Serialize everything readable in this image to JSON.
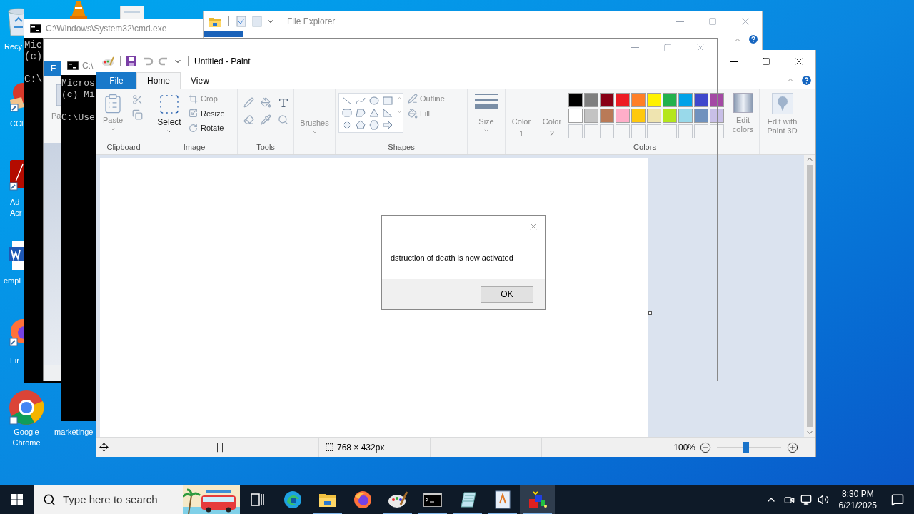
{
  "desktop": {
    "icons": [
      {
        "kind": "recycle",
        "label": "Recy"
      },
      {
        "kind": "cone"
      },
      {
        "kind": "document"
      },
      {
        "kind": "cleaner",
        "label": "CCl"
      },
      {
        "kind": "acrobat",
        "label": "Ad\nAcr"
      },
      {
        "kind": "word",
        "label": "empl"
      },
      {
        "kind": "firefox",
        "label": "Fir"
      },
      {
        "kind": "chrome",
        "label": "Google Chrome"
      },
      {
        "kind": "hidden",
        "label": "marketinge"
      }
    ]
  },
  "cmd_back": {
    "title": "C:\\Windows\\System32\\cmd.exe",
    "lines": [
      "Mic",
      "(c)",
      "C:\\"
    ]
  },
  "explorer_back": {
    "tab": "F",
    "paste_label": "Pa"
  },
  "cmd_front": {
    "title": "C:\\",
    "lines": [
      "Micros",
      "(c) Mi",
      "C:\\Use"
    ]
  },
  "file_explorer": {
    "title": "File Explorer"
  },
  "paint": {
    "title": "Untitled - Paint",
    "tabs": [
      {
        "label": "File",
        "kind": "file",
        "selected": false
      },
      {
        "label": "Home",
        "kind": "tab",
        "selected": true
      },
      {
        "label": "View",
        "kind": "tab",
        "selected": false
      }
    ],
    "clipboard": {
      "paste": {
        "label": "Paste",
        "disabled": true
      },
      "group": "Clipboard"
    },
    "image": {
      "select": {
        "label": "Select",
        "disabled": false
      },
      "actions": [
        {
          "label": "Crop",
          "disabled": true
        },
        {
          "label": "Resize",
          "disabled": false
        },
        {
          "label": "Rotate",
          "disabled": false
        }
      ],
      "group": "Image"
    },
    "tools": {
      "group": "Tools"
    },
    "brushes": {
      "label": "Brushes"
    },
    "shapes": {
      "outline": "Outline",
      "fill": "Fill",
      "group": "Shapes"
    },
    "size": {
      "label": "Size"
    },
    "color1": "Color 1",
    "color2": "Color 2",
    "colors": {
      "group": "Colors",
      "swatches": [
        {
          "color": "#000000"
        },
        {
          "color": "#7f7f7f"
        },
        {
          "color": "#880015"
        },
        {
          "color": "#ed1c24"
        },
        {
          "color": "#ff7f27"
        },
        {
          "color": "#fff200"
        },
        {
          "color": "#22b14c"
        },
        {
          "color": "#00a2e8"
        },
        {
          "color": "#3f48cc"
        },
        {
          "color": "#a349a4"
        },
        {
          "color": "#ffffff"
        },
        {
          "color": "#c3c3c3"
        },
        {
          "color": "#b97a57"
        },
        {
          "color": "#ffaec9"
        },
        {
          "color": "#ffc90e"
        },
        {
          "color": "#efe4b0"
        },
        {
          "color": "#b5e61d"
        },
        {
          "color": "#99d9ea"
        },
        {
          "color": "#7092be"
        },
        {
          "color": "#c8bfe7"
        },
        {
          "kind": "empty"
        },
        {
          "kind": "empty"
        },
        {
          "kind": "empty"
        },
        {
          "kind": "empty"
        },
        {
          "kind": "empty"
        },
        {
          "kind": "empty"
        },
        {
          "kind": "empty"
        },
        {
          "kind": "empty"
        },
        {
          "kind": "empty"
        },
        {
          "kind": "empty"
        }
      ]
    },
    "edit_colors": "Edit colors",
    "paint3d": "Edit with Paint 3D",
    "status_bar": {
      "size": "768 × 432px",
      "zoom": "100%",
      "zoom_slider": {
        "level": 0.46
      }
    }
  },
  "dialog": {
    "message": "dstruction of death is now activated",
    "button": "OK"
  },
  "taskbar": {
    "search_placeholder": "Type here to search",
    "apps": [
      {
        "kind": "taskview",
        "selected": false,
        "running": false
      },
      {
        "kind": "edge",
        "selected": false,
        "running": false
      },
      {
        "kind": "folder",
        "selected": false,
        "running": true
      },
      {
        "kind": "firefox",
        "selected": false,
        "running": false
      },
      {
        "kind": "palette",
        "selected": false,
        "running": true
      },
      {
        "kind": "console",
        "selected": false,
        "running": true
      },
      {
        "kind": "notebook",
        "selected": false,
        "running": true
      },
      {
        "kind": "wordpad",
        "selected": false,
        "running": true
      },
      {
        "kind": "cubes",
        "selected": true,
        "running": true
      }
    ],
    "time": "8:30 PM",
    "date": "6/21/2025"
  }
}
